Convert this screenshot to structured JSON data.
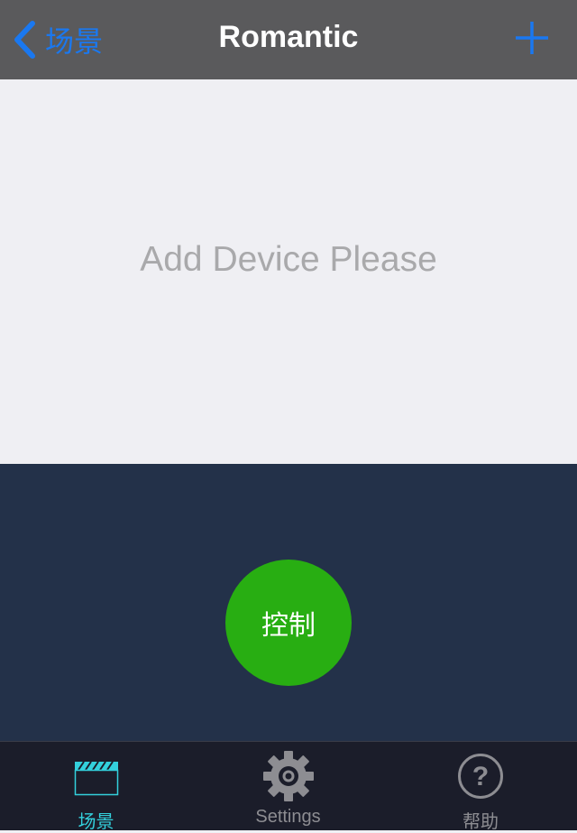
{
  "navbar": {
    "back_label": "场景",
    "title": "Romantic",
    "add_icon": "plus-icon",
    "back_icon": "chevron-left-icon"
  },
  "content": {
    "empty_message": "Add Device Please"
  },
  "control": {
    "button_label": "控制",
    "color": "#28ae12"
  },
  "tabbar": {
    "tabs": [
      {
        "label": "场景",
        "icon": "clapperboard-icon",
        "active": true
      },
      {
        "label": "Settings",
        "icon": "gear-icon",
        "active": false
      },
      {
        "label": "帮助",
        "icon": "help-circle-icon",
        "active": false
      }
    ]
  },
  "colors": {
    "accent": "#1a78f0",
    "active_tab": "#33d0dc",
    "navbar_bg": "#5a5a5c",
    "panel_bg": "#233149"
  }
}
